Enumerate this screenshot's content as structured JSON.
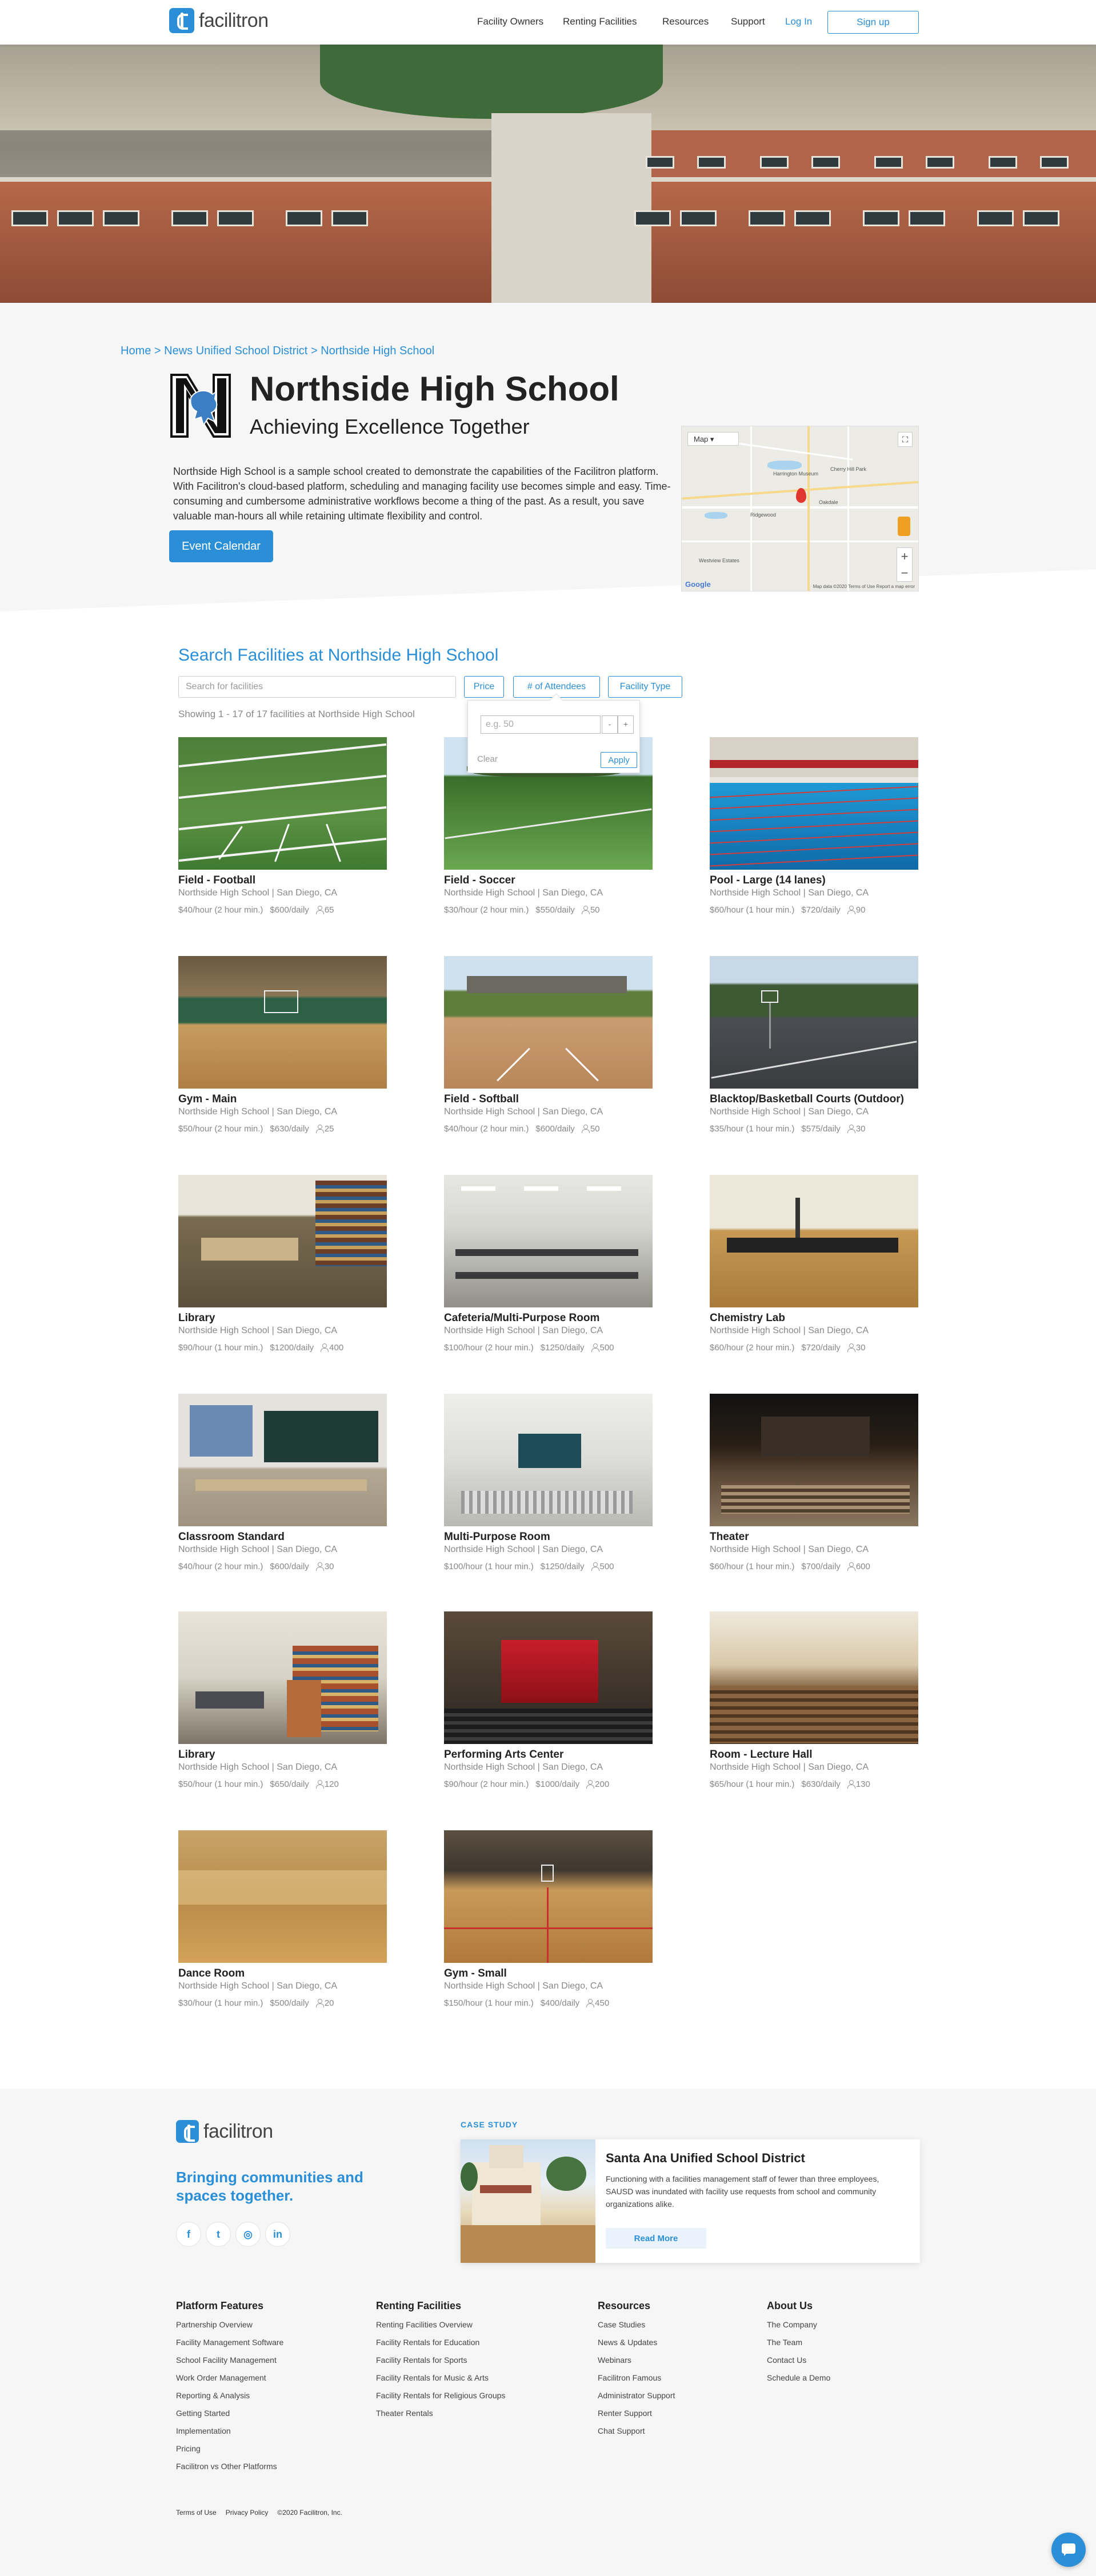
{
  "header": {
    "logo_text": "facilitron",
    "nav": [
      "Facility Owners",
      "Renting Facilities",
      "Resources",
      "Support"
    ],
    "login": "Log In",
    "signup": "Sign up"
  },
  "breadcrumb": {
    "home": "Home",
    "sep1": ">",
    "district": "News Unified School District",
    "sep2": ">",
    "school": "Northside High School"
  },
  "school": {
    "name": "Northside High School",
    "motto": "Achieving Excellence Together",
    "description": "Northside High School is a sample school created to demonstrate the capabilities of the Facilitron platform. With Facilitron's cloud-based platform, scheduling and managing facility use becomes simple and easy. Time-consuming and cumbersome administrative workflows become a thing of the past. As a result, you  save valuable man-hours all while retaining ultimate flexibility and control.",
    "event_button": "Event Calendar"
  },
  "map": {
    "type_label": "Map",
    "google": "Google",
    "attribution": "Map data ©2020   Terms of Use   Report a map error",
    "labels": [
      "Harrington Museum",
      "Cherry Hill Park",
      "Ridgewood",
      "Westview Estates",
      "Oakdale"
    ]
  },
  "search": {
    "title": "Search Facilities at Northside High School",
    "placeholder": "Search for facilities",
    "filters": [
      "Price",
      "# of Attendees",
      "Facility Type"
    ],
    "showing": "Showing 1 - 17 of 17 facilities at Northside High School",
    "popover": {
      "placeholder": "e.g. 50",
      "minus": "-",
      "plus": "+",
      "clear": "Clear",
      "apply": "Apply"
    }
  },
  "facilities": [
    {
      "title": "Field - Football",
      "location": "Northside High School | San Diego, CA",
      "hourly": "$40/hour (2 hour min.)",
      "daily": "$600/daily",
      "capacity": "65",
      "img": "football"
    },
    {
      "title": "Field - Soccer",
      "location": "Northside High School | San Diego, CA",
      "hourly": "$30/hour (2 hour min.)",
      "daily": "$550/daily",
      "capacity": "50",
      "img": "soccer"
    },
    {
      "title": "Pool - Large (14 lanes)",
      "location": "Northside High School | San Diego, CA",
      "hourly": "$60/hour (1 hour min.)",
      "daily": "$720/daily",
      "capacity": "90",
      "img": "pool"
    },
    {
      "title": "Gym - Main",
      "location": "Northside High School | San Diego, CA",
      "hourly": "$50/hour (2 hour min.)",
      "daily": "$630/daily",
      "capacity": "25",
      "img": "gym"
    },
    {
      "title": "Field - Softball",
      "location": "Northside High School | San Diego, CA",
      "hourly": "$40/hour (2 hour min.)",
      "daily": "$600/daily",
      "capacity": "50",
      "img": "softball"
    },
    {
      "title": "Blacktop/Basketball Courts (Outdoor)",
      "location": "Northside High School | San Diego, CA",
      "hourly": "$35/hour (1 hour min.)",
      "daily": "$575/daily",
      "capacity": "30",
      "img": "blacktop"
    },
    {
      "title": "Library",
      "location": "Northside High School | San Diego, CA",
      "hourly": "$90/hour (1 hour min.)",
      "daily": "$1200/daily",
      "capacity": "400",
      "img": "library"
    },
    {
      "title": "Cafeteria/Multi-Purpose Room",
      "location": "Northside High School | San Diego, CA",
      "hourly": "$100/hour (2 hour min.)",
      "daily": "$1250/daily",
      "capacity": "500",
      "img": "cafeteria"
    },
    {
      "title": "Chemistry Lab",
      "location": "Northside High School | San Diego, CA",
      "hourly": "$60/hour (2 hour min.)",
      "daily": "$720/daily",
      "capacity": "30",
      "img": "chemlab"
    },
    {
      "title": "Classroom Standard",
      "location": "Northside High School | San Diego, CA",
      "hourly": "$40/hour (2 hour min.)",
      "daily": "$600/daily",
      "capacity": "30",
      "img": "classroom"
    },
    {
      "title": "Multi-Purpose Room",
      "location": "Northside High School | San Diego, CA",
      "hourly": "$100/hour (1 hour min.)",
      "daily": "$1250/daily",
      "capacity": "500",
      "img": "multipurpose"
    },
    {
      "title": "Theater",
      "location": "Northside High School | San Diego, CA",
      "hourly": "$60/hour (1 hour min.)",
      "daily": "$700/daily",
      "capacity": "600",
      "img": "theater"
    },
    {
      "title": "Library",
      "location": "Northside High School | San Diego, CA",
      "hourly": "$50/hour (1 hour min.)",
      "daily": "$650/daily",
      "capacity": "120",
      "img": "library2"
    },
    {
      "title": "Performing Arts Center",
      "location": "Northside High School | San Diego, CA",
      "hourly": "$90/hour (2 hour min.)",
      "daily": "$1000/daily",
      "capacity": "200",
      "img": "pac"
    },
    {
      "title": "Room - Lecture Hall",
      "location": "Northside High School | San Diego, CA",
      "hourly": "$65/hour (1 hour min.)",
      "daily": "$630/daily",
      "capacity": "130",
      "img": "lecture"
    },
    {
      "title": "Dance Room",
      "location": "Northside High School | San Diego, CA",
      "hourly": "$30/hour (1 hour min.)",
      "daily": "$500/daily",
      "capacity": "20",
      "img": "dance"
    },
    {
      "title": "Gym - Small",
      "location": "Northside High School | San Diego, CA",
      "hourly": "$150/hour (1 hour min.)",
      "daily": "$400/daily",
      "capacity": "450",
      "img": "gymsmall"
    }
  ],
  "footer": {
    "logo_text": "facilitron",
    "tagline": "Bringing communities and spaces together.",
    "social": [
      "f",
      "t",
      "◎",
      "in"
    ],
    "case_label": "CASE STUDY",
    "case_title": "Santa Ana Unified School District",
    "case_body": "Functioning with a facilities management staff of fewer than three employees, SAUSD was inundated with facility use requests from school and community organizations alike.",
    "case_button": "Read More",
    "columns": [
      {
        "head": "Platform Features",
        "items": [
          "Partnership Overview",
          "Facility Management Software",
          "School Facility Management",
          "Work Order Management",
          "Reporting & Analysis",
          "Getting Started",
          "Implementation",
          "Pricing",
          "Facilitron vs Other Platforms"
        ]
      },
      {
        "head": "Renting Facilities",
        "items": [
          "Renting Facilities Overview",
          "Facility Rentals for Education",
          "Facility Rentals for Sports",
          "Facility Rentals for Music & Arts",
          "Facility Rentals for Religious Groups",
          "Theater Rentals"
        ]
      },
      {
        "head": "Resources",
        "items": [
          "Case Studies",
          "News & Updates",
          "Webinars",
          "Facilitron Famous",
          "Administrator Support",
          "Renter Support",
          "Chat Support"
        ]
      },
      {
        "head": "About Us",
        "items": [
          "The Company",
          "The Team",
          "Contact Us",
          "Schedule a Demo"
        ]
      }
    ],
    "legal": [
      "Terms of Use",
      "Privacy Policy",
      "©2020 Facilitron, Inc."
    ]
  }
}
